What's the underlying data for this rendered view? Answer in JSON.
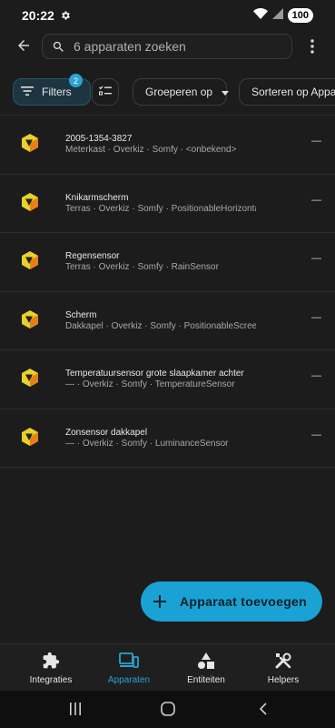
{
  "status_bar": {
    "time": "20:22",
    "battery": "100"
  },
  "search": {
    "placeholder": "6 apparaten zoeken"
  },
  "toolbar": {
    "filters_label": "Filters",
    "filters_count": "2",
    "group_label": "Groeperen op",
    "sort_label": "Sorteren op Apparaat"
  },
  "devices": [
    {
      "name": "2005-1354-3827",
      "subtitle": "Meterkast · Overkiz · Somfy · <onbekend>",
      "value": "—"
    },
    {
      "name": "Knikarmscherm",
      "subtitle": "Terras · Overkiz · Somfy · PositionableHorizontalAwning",
      "value": "—"
    },
    {
      "name": "Regensensor",
      "subtitle": "Terras · Overkiz · Somfy · RainSensor",
      "value": "—"
    },
    {
      "name": "Scherm",
      "subtitle": "Dakkapel · Overkiz · Somfy · PositionableScreen",
      "value": "—"
    },
    {
      "name": "Temperatuursensor grote slaapkamer achter",
      "subtitle": "— · Overkiz · Somfy · TemperatureSensor",
      "value": "—"
    },
    {
      "name": "Zonsensor dakkapel",
      "subtitle": "— · Overkiz · Somfy · LuminanceSensor",
      "value": "—"
    }
  ],
  "fab": {
    "label": "Apparaat toevoegen"
  },
  "bottom_nav": [
    {
      "label": "Integraties",
      "icon": "puzzle-icon"
    },
    {
      "label": "Apparaten",
      "icon": "devices-icon",
      "active": true
    },
    {
      "label": "Entiteiten",
      "icon": "shapes-icon"
    },
    {
      "label": "Helpers",
      "icon": "tools-icon"
    }
  ],
  "colors": {
    "accent": "#1aa2d4",
    "background": "#1c1c1c",
    "logo_yellow": "#e8d12a",
    "logo_orange": "#e8801a"
  }
}
